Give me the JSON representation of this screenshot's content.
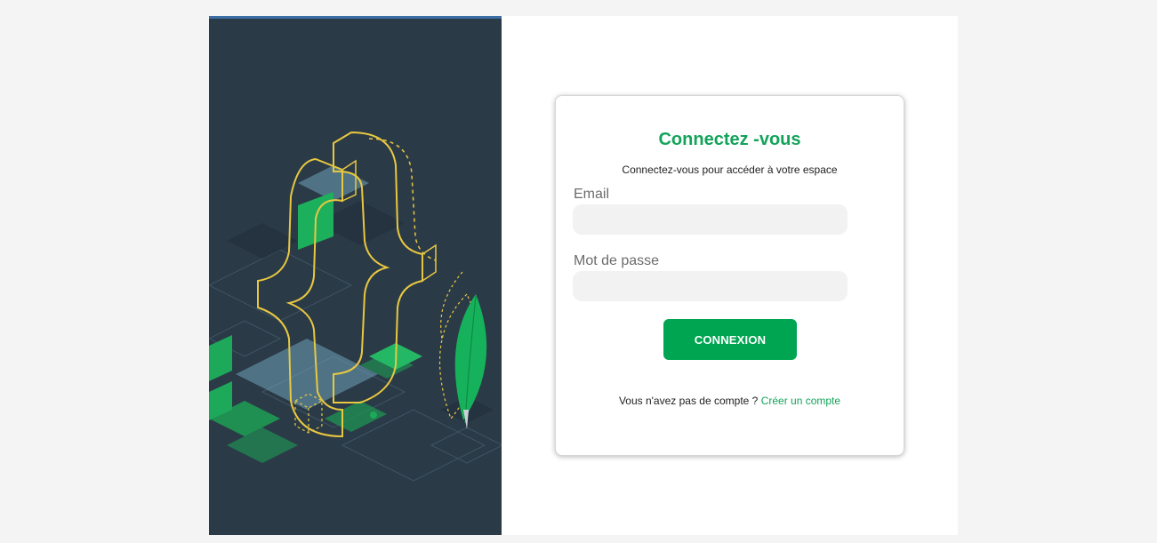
{
  "colors": {
    "accent": "#14a35a",
    "button": "#00a551",
    "hero_bg": "#2b3a47",
    "hero_top_bar": "#3b6ea5",
    "page_bg": "#f4f4f4"
  },
  "hero": {
    "illustration": "curly-braces-leaf-illustration"
  },
  "login": {
    "title": "Connectez -vous",
    "subtitle": "Connectez-vous pour accéder à votre espace",
    "email_label": "Email",
    "email_value": "",
    "password_label": "Mot de passe",
    "password_value": "",
    "submit_label": "CONNEXION",
    "signup_prompt": "Vous n'avez pas de compte ?",
    "signup_link": "Créer un compte"
  }
}
